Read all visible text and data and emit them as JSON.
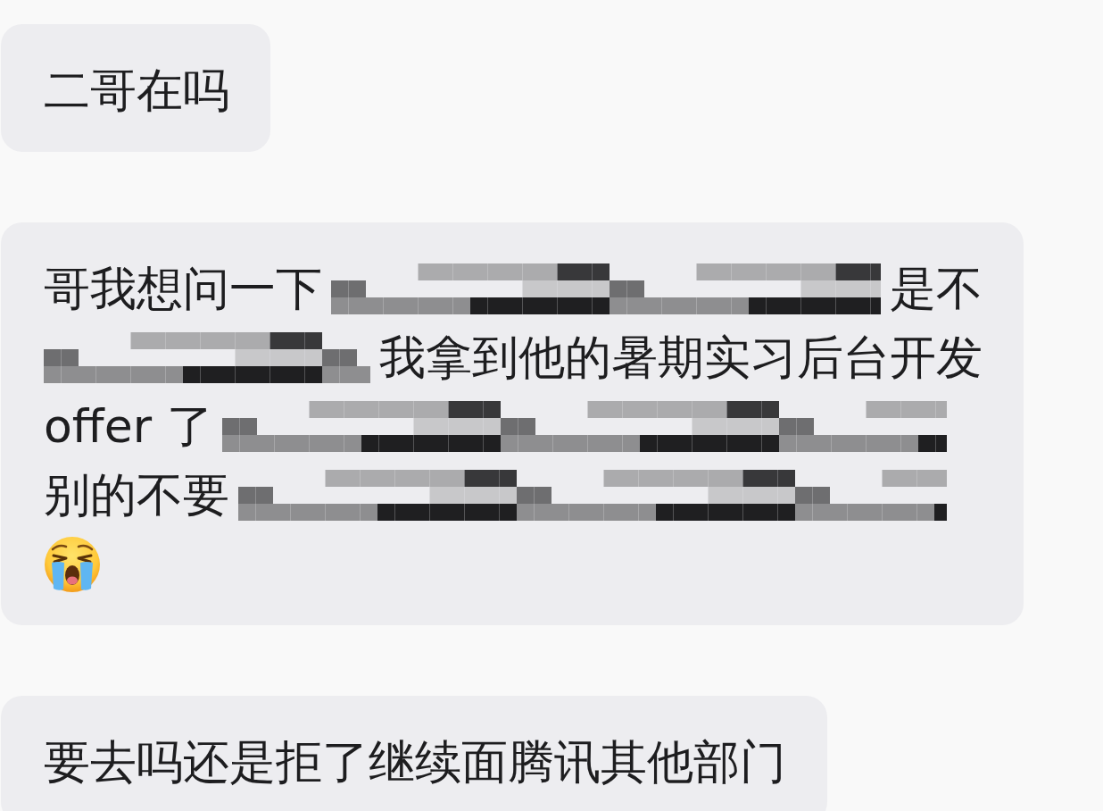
{
  "messages": [
    {
      "lines": [
        {
          "parts": [
            {
              "kind": "text",
              "text": "二哥在吗"
            }
          ]
        }
      ]
    },
    {
      "lines": [
        {
          "parts": [
            {
              "kind": "text",
              "text": "哥我想问一下"
            },
            {
              "kind": "redacted"
            },
            {
              "kind": "text",
              "text": "是不"
            }
          ]
        },
        {
          "parts": [
            {
              "kind": "redacted"
            },
            {
              "kind": "text",
              "text": "我拿到他的暑期实习后台开发"
            }
          ]
        },
        {
          "parts": [
            {
              "kind": "text",
              "text": "offer 了"
            },
            {
              "kind": "redacted"
            }
          ]
        },
        {
          "parts": [
            {
              "kind": "text",
              "text": "别的不要"
            },
            {
              "kind": "redacted"
            }
          ]
        },
        {
          "parts": [
            {
              "kind": "emoji"
            }
          ]
        }
      ]
    },
    {
      "lines": [
        {
          "parts": [
            {
              "kind": "text",
              "text": "要去吗还是拒了继续面腾讯其他部门"
            }
          ]
        }
      ]
    }
  ]
}
